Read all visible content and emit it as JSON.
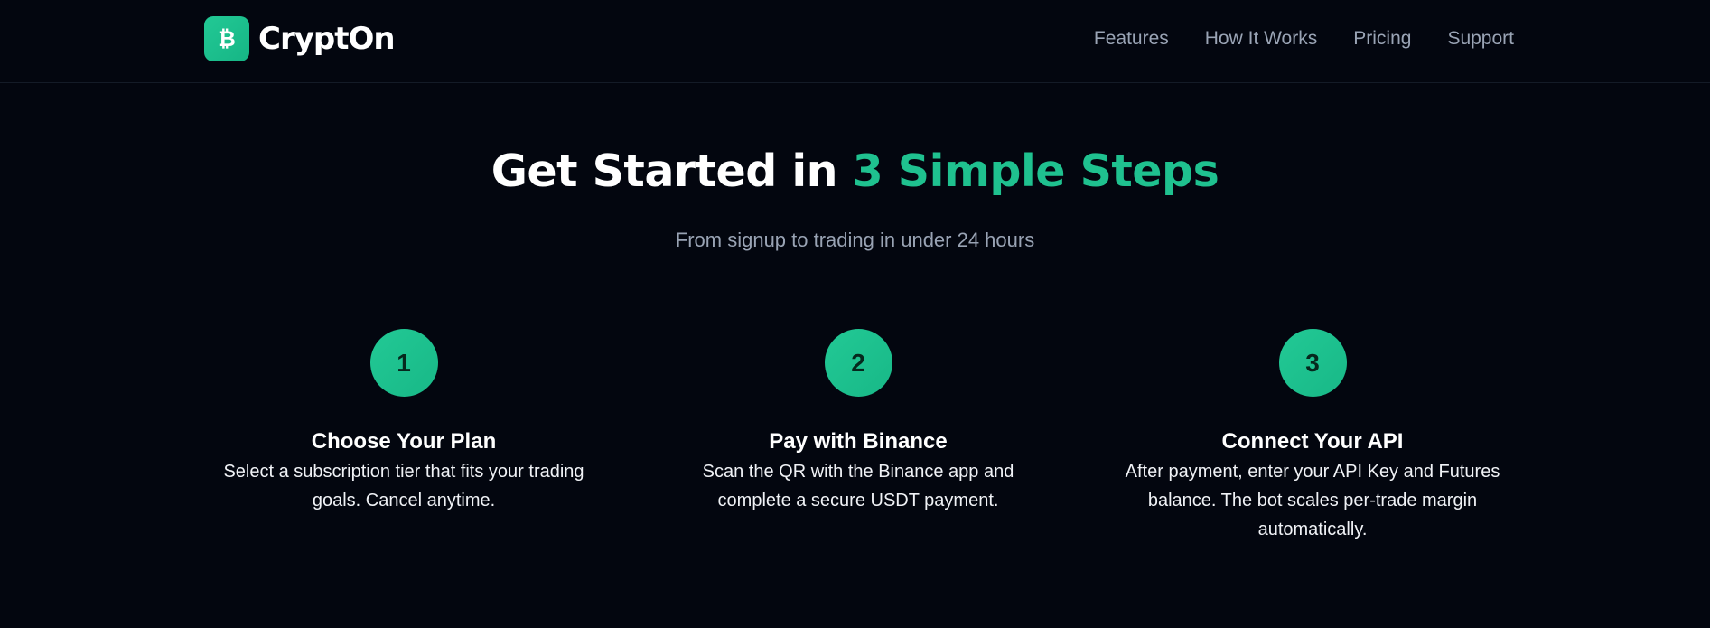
{
  "nav": {
    "brand_name": "CryptOn",
    "logo_icon": "bitcoin-icon",
    "links": [
      {
        "label": "Features"
      },
      {
        "label": "How It Works"
      },
      {
        "label": "Pricing"
      },
      {
        "label": "Support"
      }
    ]
  },
  "hero": {
    "title_prefix": "Get Started in ",
    "title_accent": "3 Simple Steps",
    "subtitle": "From signup to trading in under 24 hours"
  },
  "steps": [
    {
      "number": "1",
      "title": "Choose Your Plan",
      "description": "Select a subscription tier that fits your trading goals. Cancel anytime."
    },
    {
      "number": "2",
      "title": "Pay with Binance",
      "description": "Scan the QR with the Binance app and complete a secure USDT payment."
    },
    {
      "number": "3",
      "title": "Connect Your API",
      "description": "After payment, enter your API Key and Futures balance. The bot scales per-trade margin automatically."
    }
  ],
  "colors": {
    "background": "#03060f",
    "accent": "#1fc18f",
    "nav_text": "#9aa4b5",
    "subtitle_text": "#99a3b4"
  }
}
